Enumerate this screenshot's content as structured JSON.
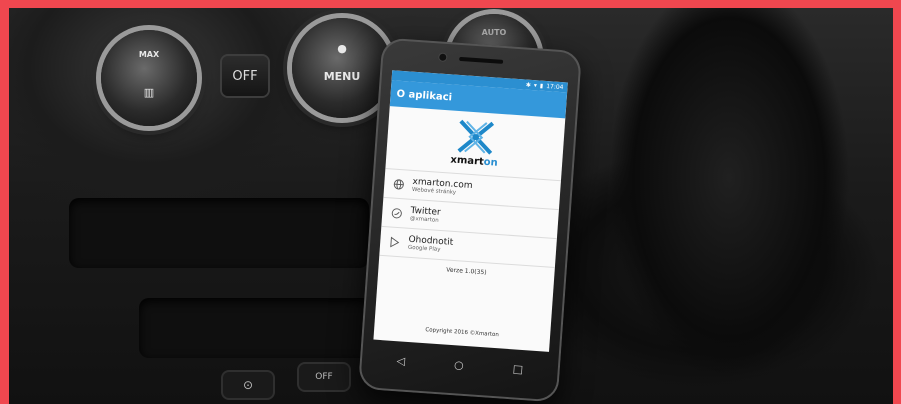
{
  "console": {
    "knob_left_label": "MAX",
    "off_label": "OFF",
    "knob_menu_label": "MENU",
    "knob_right_label": "AUTO",
    "bottom_off_label": "OFF"
  },
  "status_bar": {
    "time": "17:04"
  },
  "app": {
    "title": "O aplikaci",
    "brand": {
      "prefix": "xmart",
      "suffix": "on"
    },
    "items": [
      {
        "title": "xmarton.com",
        "subtitle": "Webové stránky",
        "icon": "globe-icon"
      },
      {
        "title": "Twitter",
        "subtitle": "@xmarton",
        "icon": "twitter-icon"
      },
      {
        "title": "Ohodnotit",
        "subtitle": "Google Play",
        "icon": "play-store-icon"
      }
    ],
    "version": "Verze 1.0(35)",
    "copyright": "Copyright 2016 ©Xmarton"
  },
  "navbar": {
    "back": "◁",
    "home": "○",
    "recents": "□"
  },
  "colors": {
    "frame": "#f0474f",
    "accent": "#3498db"
  }
}
